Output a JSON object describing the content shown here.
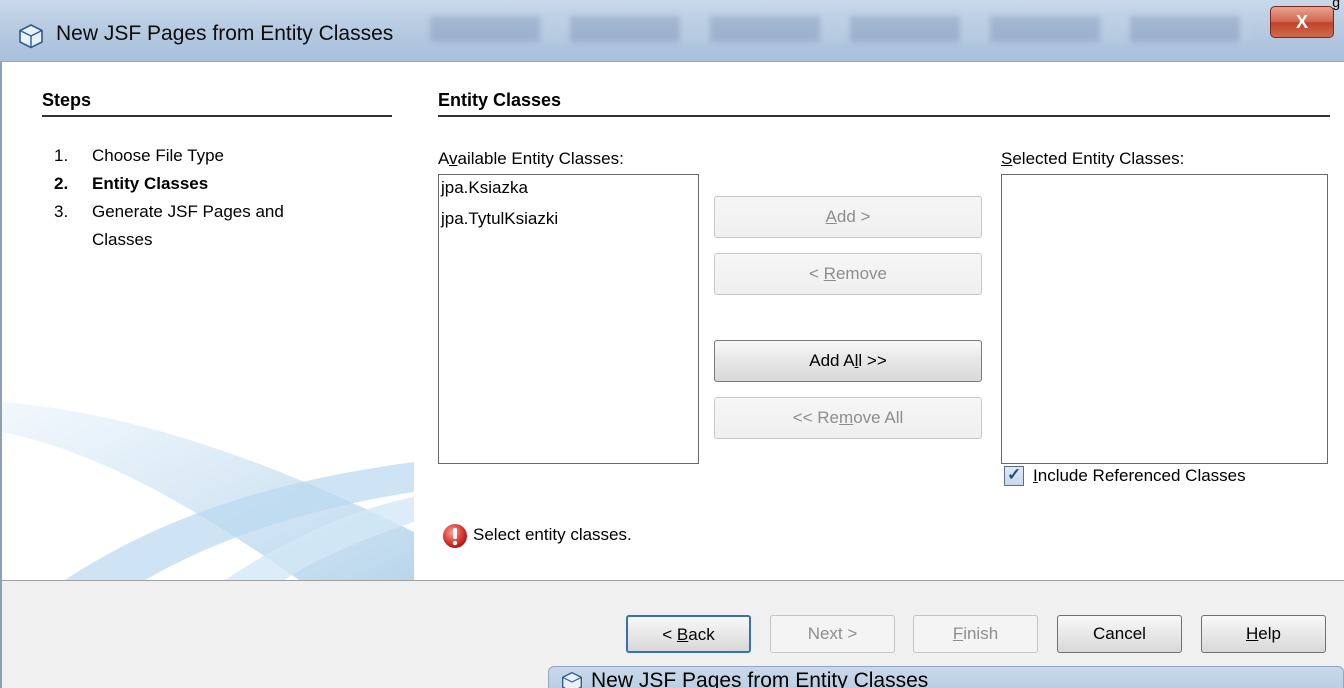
{
  "window": {
    "title": "New JSF Pages from Entity Classes",
    "close_glyph": "X",
    "corner_text": "g"
  },
  "steps": {
    "title": "Steps",
    "items": [
      {
        "num": "1.",
        "label": "Choose File Type"
      },
      {
        "num": "2.",
        "label": "Entity Classes"
      },
      {
        "num": "3.",
        "label": "Generate JSF Pages and"
      },
      {
        "num": "",
        "label": "Classes"
      }
    ]
  },
  "content": {
    "title": "Entity Classes",
    "available_label_pre": "A",
    "available_label_mn": "v",
    "available_label_post": "ailable Entity Classes:",
    "selected_label_mn": "S",
    "selected_label_post": "elected Entity Classes:",
    "available_items": [
      "jpa.Ksiazka",
      "jpa.TytulKsiazki"
    ],
    "buttons": {
      "add_mn": "A",
      "add_post": "dd >",
      "remove_pre": "< ",
      "remove_mn": "R",
      "remove_post": "emove",
      "add_all_pre": "Add A",
      "add_all_mn": "l",
      "add_all_post": "l >>",
      "remove_all_pre": "<< Re",
      "remove_all_mn": "m",
      "remove_all_post": "ove All"
    },
    "include_mn": "I",
    "include_post": "nclude Referenced Classes",
    "include_checked": true,
    "error_message": "Select entity classes."
  },
  "footer": {
    "back_pre": "< ",
    "back_mn": "B",
    "back_post": "ack",
    "next": "Next >",
    "finish_mn": "F",
    "finish_post": "inish",
    "cancel": "Cancel",
    "help_mn": "H",
    "help_post": "elp"
  },
  "second_window_title": "New JSF Pages from Entity Classes",
  "colors": {
    "titlebar": "#b7cbe1",
    "close": "#c0432b",
    "error": "#c8262a",
    "swoosh": "#9cc3e4"
  }
}
